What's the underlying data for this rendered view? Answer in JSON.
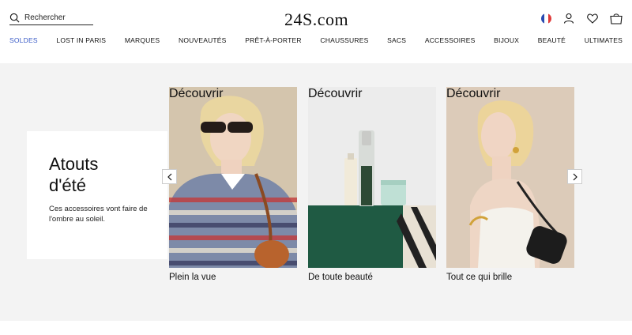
{
  "header": {
    "search_placeholder": "Rechercher",
    "logo": "24S.com"
  },
  "icons": {
    "flag": "france-flag-icon",
    "account": "user-icon",
    "wishlist": "heart-icon",
    "bag": "shopping-bag-icon"
  },
  "nav": {
    "items": [
      "SOLDES",
      "LOST IN PARIS",
      "MARQUES",
      "NOUVEAUTÉS",
      "PRÊT-À-PORTER",
      "CHAUSSURES",
      "SACS",
      "ACCESSOIRES",
      "BIJOUX",
      "BEAUTÉ",
      "ULTIMATES"
    ],
    "active_color": "#3a5bc7"
  },
  "promo": {
    "title_line1": "Atouts",
    "title_line2": "d'été",
    "text": "Ces accessoires vont faire de l'ombre au soleil."
  },
  "cards": [
    {
      "title": "Plein la vue",
      "link": "Découvrir"
    },
    {
      "title": "De toute beauté",
      "link": "Découvrir"
    },
    {
      "title": "Tout ce qui brille",
      "link": "Découvrir"
    }
  ],
  "colors": {
    "band_bg": "#f3f3f3",
    "accent_blue": "#3a5bc7"
  }
}
